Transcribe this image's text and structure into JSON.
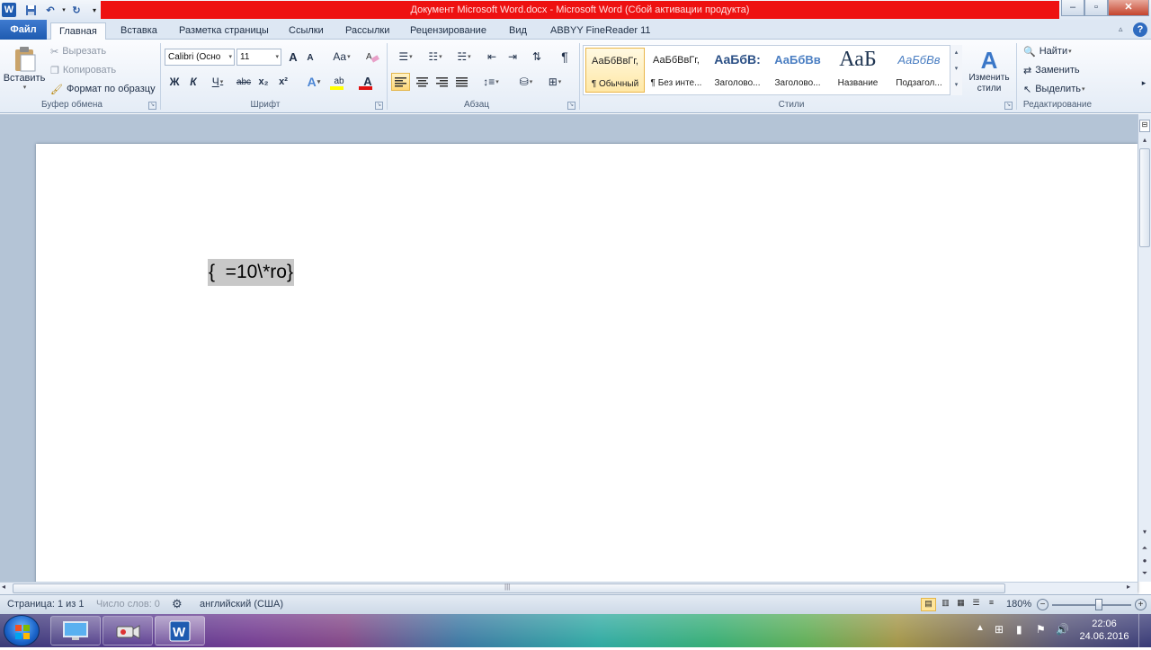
{
  "window": {
    "title": "Документ Microsoft Word.docx  -  Microsoft Word (Сбой активации продукта)"
  },
  "tabs": {
    "file": "Файл",
    "items": [
      "Главная",
      "Вставка",
      "Разметка страницы",
      "Ссылки",
      "Рассылки",
      "Рецензирование",
      "Вид",
      "ABBYY FineReader 11"
    ]
  },
  "clipboard": {
    "paste": "Вставить",
    "cut": "Вырезать",
    "copy": "Копировать",
    "format_painter": "Формат по образцу",
    "label": "Буфер обмена"
  },
  "font": {
    "family": "Calibri (Осно",
    "size": "11",
    "label": "Шрифт",
    "bold": "Ж",
    "italic": "К",
    "underline": "Ч",
    "strike": "abc",
    "subscript": "x₂",
    "superscript": "x²",
    "grow": "A",
    "shrink": "A",
    "case": "Aa",
    "color_letter": "A",
    "highlight_letter": "ab",
    "effects_letter": "A"
  },
  "paragraph": {
    "label": "Абзац",
    "pilcrow": "¶"
  },
  "styles": {
    "label": "Стили",
    "items": [
      {
        "sample": "АаБбВвГг,",
        "name": "¶ Обычный"
      },
      {
        "sample": "АаБбВвГг,",
        "name": "¶ Без инте..."
      },
      {
        "sample": "АаБбВ:",
        "name": "Заголово..."
      },
      {
        "sample": "АаБбВв",
        "name": "Заголово..."
      },
      {
        "sample": "АаБ",
        "name": "Название"
      },
      {
        "sample": "АаБбВв",
        "name": "Подзагол..."
      }
    ],
    "change": "Изменить стили"
  },
  "editing": {
    "label": "Редактирование",
    "find": "Найти",
    "replace": "Заменить",
    "select": "Выделить"
  },
  "document": {
    "field_code": "{  =10\\*ro}"
  },
  "status": {
    "page": "Страница: 1 из 1",
    "words": "Число слов: 0",
    "language": "английский (США)",
    "zoom": "180%"
  },
  "taskbar": {
    "time": "22:06",
    "date": "24.06.2016"
  },
  "colors": {
    "accent": "#1e5bb0",
    "title_highlight": "#ee1111",
    "font_color_bar": "#e01010",
    "highlight_bar": "#ffff00"
  }
}
